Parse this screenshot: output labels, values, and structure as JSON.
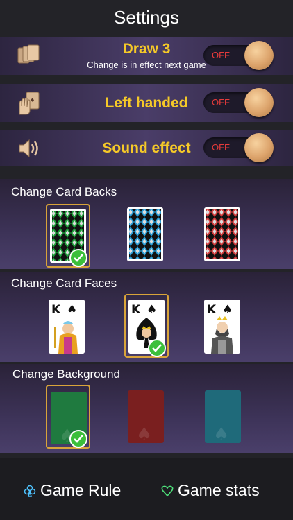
{
  "header": {
    "title": "Settings"
  },
  "settings": [
    {
      "icon": "cards-stack-icon",
      "title": "Draw 3",
      "subtitle": "Change is in effect next game",
      "toggle": "OFF"
    },
    {
      "icon": "hand-card-icon",
      "title": "Left handed",
      "toggle": "OFF"
    },
    {
      "icon": "speaker-icon",
      "title": "Sound effect",
      "toggle": "OFF"
    }
  ],
  "sections": {
    "backs": {
      "title": "Change Card Backs",
      "selected_index": 0,
      "colors": [
        "#1e9e3a",
        "#2a9fd8",
        "#d23a3a"
      ]
    },
    "faces": {
      "title": "Change Card Faces",
      "selected_index": 1,
      "rank": "K"
    },
    "background": {
      "title": "Change Background",
      "selected_index": 0,
      "colors": [
        "#1f7a3f",
        "#7a1f1f",
        "#1f6a7a"
      ]
    }
  },
  "footer": {
    "rule_label": "Game Rule",
    "stats_label": "Game stats"
  },
  "colors": {
    "accent": "#f5c928",
    "toggle_off": "#e63b3b",
    "selected_border": "#d9a43a",
    "check": "#3bbf3b"
  }
}
